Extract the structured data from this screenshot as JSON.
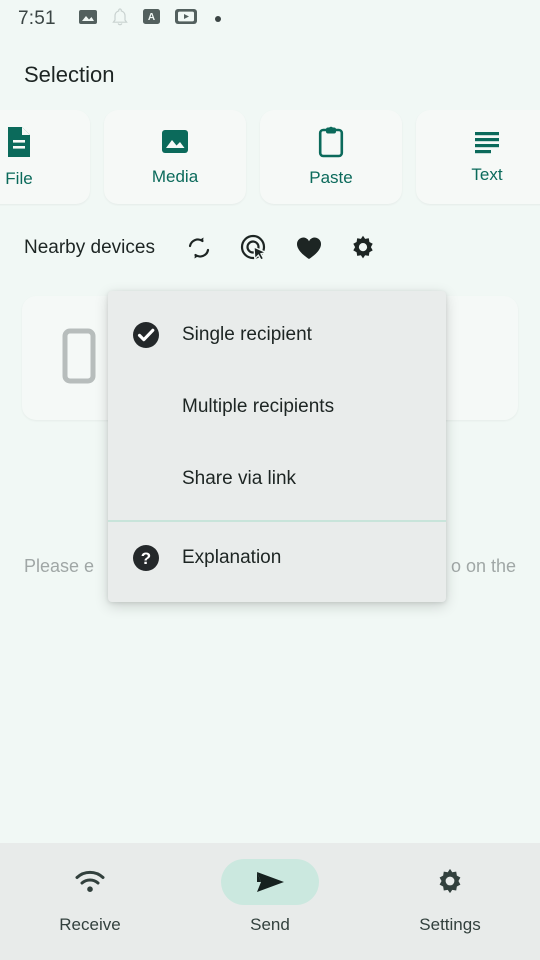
{
  "status_bar": {
    "time": "7:51",
    "icons": [
      "image-icon",
      "notification-bell-icon",
      "a-badge-icon",
      "video-player-icon",
      "dot-indicator"
    ]
  },
  "header": {
    "title": "Selection"
  },
  "selection_chips": [
    {
      "label": "File",
      "icon": "file-document-icon"
    },
    {
      "label": "Media",
      "icon": "image-icon"
    },
    {
      "label": "Paste",
      "icon": "clipboard-icon"
    },
    {
      "label": "Text",
      "icon": "text-lines-icon"
    }
  ],
  "nearby": {
    "title": "Nearby devices",
    "actions": [
      {
        "name": "refresh-icon"
      },
      {
        "name": "scan-target-icon"
      },
      {
        "name": "heart-icon"
      },
      {
        "name": "gear-icon"
      }
    ]
  },
  "device_card": {
    "icon": "phone-device-icon"
  },
  "hint": {
    "left": "Please e",
    "right": "o on the"
  },
  "menu": {
    "items": [
      {
        "label": "Single recipient",
        "icon": "check-circle-icon",
        "selected": true
      },
      {
        "label": "Multiple recipients",
        "icon": "",
        "selected": false
      },
      {
        "label": "Share via link",
        "icon": "",
        "selected": false
      }
    ],
    "footer": [
      {
        "label": "Explanation",
        "icon": "question-circle-icon"
      }
    ]
  },
  "bottom_nav": [
    {
      "label": "Receive",
      "icon": "wifi-icon",
      "active": false
    },
    {
      "label": "Send",
      "icon": "send-icon",
      "active": true
    },
    {
      "label": "Settings",
      "icon": "gear-icon",
      "active": false
    }
  ],
  "colors": {
    "background": "#f1f8f5",
    "accent_teal": "#0b6a5b",
    "card": "#f6f9f7",
    "menu_bg": "#e9eceb",
    "nav_bg": "#e8ebea",
    "active_pill": "#cbe8df",
    "text_primary": "#1d2523",
    "text_muted": "#a0a7a6",
    "divider": "#c8e4da"
  }
}
